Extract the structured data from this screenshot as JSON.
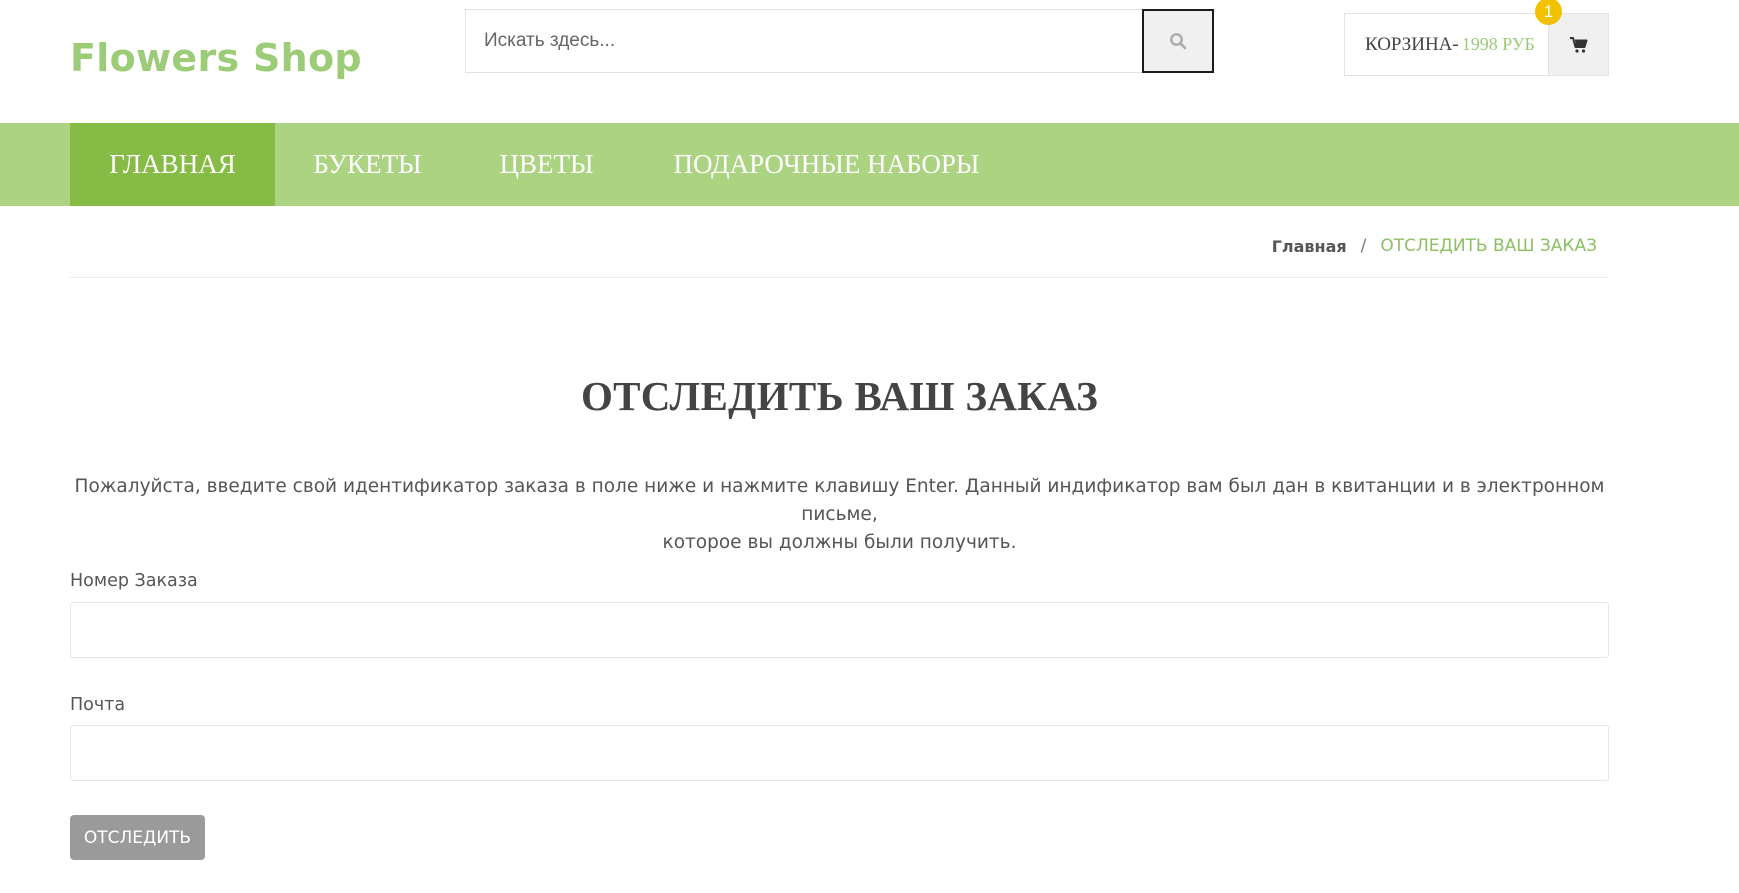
{
  "header": {
    "logo": "Flowers Shop",
    "search": {
      "placeholder": "Искать здесь...",
      "icon": "search-icon"
    },
    "cart": {
      "label": "КОРЗИНА-",
      "price": "1998 РУБ",
      "count": "1",
      "icon": "cart-icon"
    }
  },
  "nav": {
    "items": [
      {
        "label": "ГЛАВНАЯ",
        "active": true
      },
      {
        "label": "БУКЕТЫ"
      },
      {
        "label": "ЦВЕТЫ"
      },
      {
        "label": "ПОДАРОЧНЫЕ НАБОРЫ"
      }
    ]
  },
  "breadcrumb": {
    "home": "Главная",
    "separator": "/",
    "current": "ОТСЛЕДИТЬ ВАШ ЗАКАЗ"
  },
  "main": {
    "title": "ОТСЛЕДИТЬ ВАШ ЗАКАЗ",
    "intro_line1": "Пожалуйста, введите свой идентификатор заказа в поле ниже и нажмите клавишу Enter. Данный индификатор вам был дан в квитанции и в электронном письме,",
    "intro_line2": "которое вы должны были получить.",
    "order_label": "Номер Заказа",
    "order_value": "",
    "email_label": "Почта",
    "email_value": "",
    "submit": "ОТСЛЕДИТЬ"
  },
  "colors": {
    "accent": "#9ccc78",
    "nav_bg": "#acd382",
    "nav_active": "#86bb45",
    "badge": "#f2c200",
    "button": "#9a9a9a"
  }
}
